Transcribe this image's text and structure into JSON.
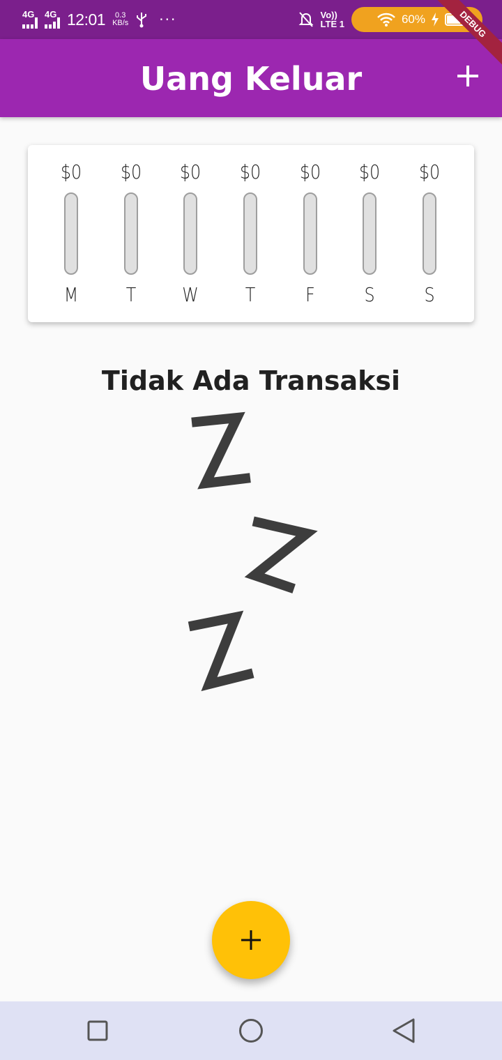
{
  "status_bar": {
    "signal1": "4G",
    "signal2": "4G",
    "time": "12:01",
    "speed_value": "0.3",
    "speed_unit": "KB/s",
    "more": "···",
    "lte_top": "Vo))",
    "lte_bottom": "LTE 1",
    "battery_percent": "60%",
    "battery_level": 0.6
  },
  "debug_banner": "DEBUG",
  "app_bar": {
    "title": "Uang Keluar",
    "add_icon": "plus-icon"
  },
  "chart_data": {
    "type": "bar",
    "categories": [
      "M",
      "T",
      "W",
      "T",
      "F",
      "S",
      "S"
    ],
    "values": [
      0,
      0,
      0,
      0,
      0,
      0,
      0
    ],
    "labels": [
      "$0",
      "$0",
      "$0",
      "$0",
      "$0",
      "$0",
      "$0"
    ],
    "title": "",
    "xlabel": "",
    "ylabel": "",
    "ylim": [
      0,
      1
    ]
  },
  "empty_state": {
    "title": "Tidak Ada Transaksi",
    "image_icon": "sleeping-zzz-icon"
  },
  "fab": {
    "icon": "plus-icon"
  },
  "nav_bar": {
    "recent_icon": "square-icon",
    "home_icon": "circle-icon",
    "back_icon": "triangle-back-icon"
  },
  "colors": {
    "status_bar": "#7b1f8c",
    "app_bar": "#9c27b0",
    "fab": "#ffc107",
    "nav_bar": "#dfe1f4",
    "battery_pill": "#f0a21f"
  }
}
